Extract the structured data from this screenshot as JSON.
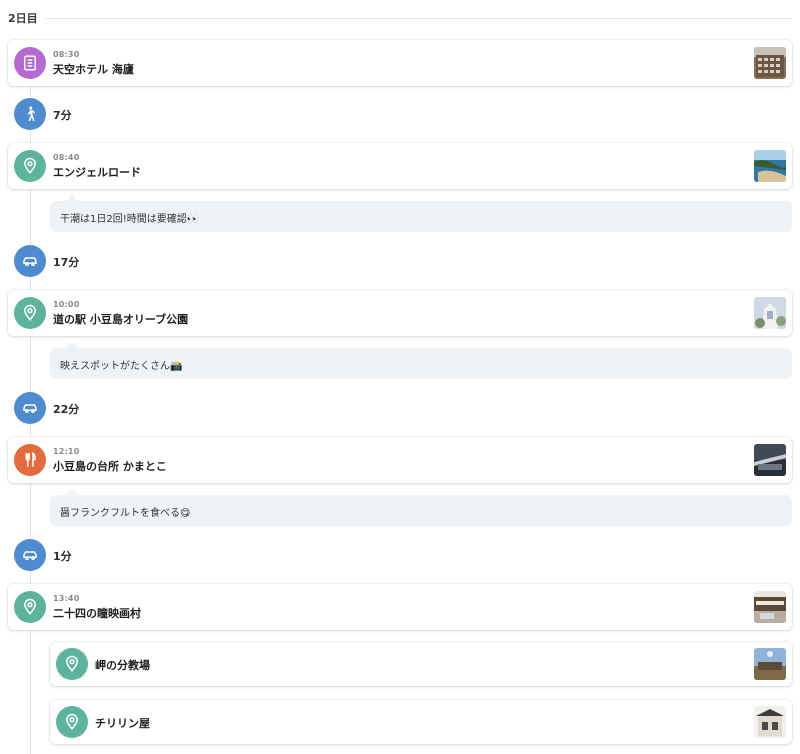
{
  "day": {
    "label": "2日目"
  },
  "spots": [
    {
      "time": "08:30",
      "name": "天空ホテル 海廬",
      "icon": "hotel-icon",
      "color": "#b56ad3"
    },
    {
      "time": "08:40",
      "name": "エンジェルロード",
      "icon": "map-pin-icon",
      "color": "#5eb39d",
      "note": "干潮は1日2回!時間は要確認👀"
    },
    {
      "time": "10:00",
      "name": "道の駅 小豆島オリーブ公園",
      "icon": "map-pin-icon",
      "color": "#5eb39d",
      "note": "映えスポットがたくさん📸"
    },
    {
      "time": "12:10",
      "name": "小豆島の台所 かまとこ",
      "icon": "fork-knife-icon",
      "color": "#e46b40",
      "note": "醤フランクフルトを食べる😋"
    },
    {
      "time": "13:40",
      "name": "二十四の瞳映画村",
      "icon": "map-pin-icon",
      "color": "#5eb39d",
      "sub_spots": [
        {
          "name": "岬の分教場",
          "icon": "map-pin-icon"
        },
        {
          "name": "チリリン屋",
          "icon": "map-pin-icon"
        }
      ]
    }
  ],
  "moves": [
    {
      "duration": "7分",
      "icon": "walk-icon"
    },
    {
      "duration": "17分",
      "icon": "car-icon"
    },
    {
      "duration": "22分",
      "icon": "car-icon"
    },
    {
      "duration": "1分",
      "icon": "car-icon"
    }
  ],
  "colors": {
    "move": "#4f8ccf",
    "note_bg": "#f0f3f6"
  }
}
